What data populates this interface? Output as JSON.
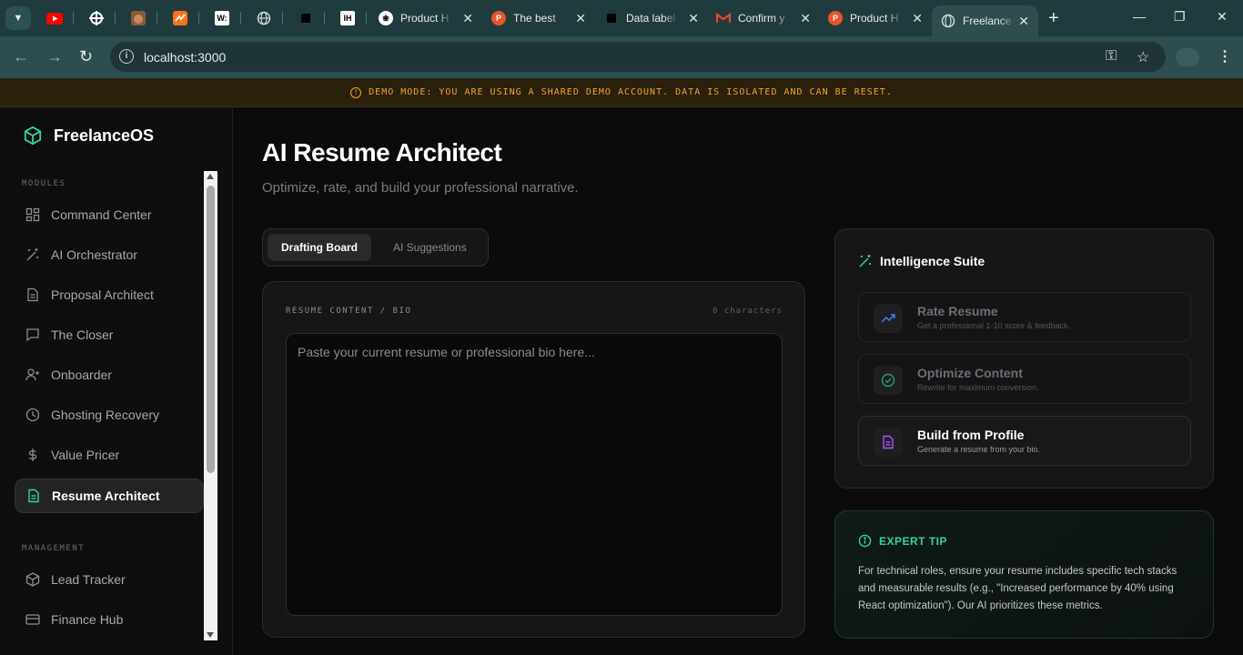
{
  "browser": {
    "tabs": [
      {
        "title": "Product H",
        "favicon": "openai-icon"
      },
      {
        "title": "The best",
        "favicon": "producthunt-icon"
      },
      {
        "title": "Data label",
        "favicon": "black-square-icon"
      },
      {
        "title": "Confirm y",
        "favicon": "gmail-icon"
      },
      {
        "title": "Product H",
        "favicon": "producthunt-icon"
      },
      {
        "title": "Freelance",
        "favicon": "globe-icon",
        "active": true
      }
    ],
    "pinned_labels": {
      "w": "W:",
      "ih": "IH"
    },
    "url": "localhost:3000"
  },
  "banner": {
    "text": "DEMO MODE: YOU ARE USING A SHARED DEMO ACCOUNT. DATA IS ISOLATED AND CAN BE RESET.",
    "color": "#f2a431"
  },
  "sidebar": {
    "brand": "FreelanceOS",
    "modules_label": "MODULES",
    "modules": [
      {
        "label": "Command Center",
        "icon": "grid-icon"
      },
      {
        "label": "AI Orchestrator",
        "icon": "magic-wand-icon"
      },
      {
        "label": "Proposal Architect",
        "icon": "document-icon"
      },
      {
        "label": "The Closer",
        "icon": "chat-icon"
      },
      {
        "label": "Onboarder",
        "icon": "user-plus-icon"
      },
      {
        "label": "Ghosting Recovery",
        "icon": "clock-icon"
      },
      {
        "label": "Value Pricer",
        "icon": "dollar-icon"
      },
      {
        "label": "Resume Architect",
        "icon": "document-icon",
        "active": true
      }
    ],
    "management_label": "MANAGEMENT",
    "management": [
      {
        "label": "Lead Tracker",
        "icon": "box-icon"
      },
      {
        "label": "Finance Hub",
        "icon": "card-icon"
      }
    ]
  },
  "main": {
    "title": "AI Resume Architect",
    "subtitle": "Optimize, rate, and build your professional narrative.",
    "tabs": [
      {
        "label": "Drafting Board",
        "active": true
      },
      {
        "label": "AI Suggestions"
      }
    ],
    "editor": {
      "label": "RESUME CONTENT / BIO",
      "count": "0 characters",
      "placeholder": "Paste your current resume or professional bio here..."
    },
    "suite": {
      "title": "Intelligence Suite",
      "actions": [
        {
          "name": "Rate Resume",
          "desc": "Get a professional 1-10 score & feedback.",
          "icon": "trending-up-icon",
          "enabled": false
        },
        {
          "name": "Optimize Content",
          "desc": "Rewrite for maximum conversion.",
          "icon": "check-circle-icon",
          "enabled": false
        },
        {
          "name": "Build from Profile",
          "desc": "Generate a resume from your bio.",
          "icon": "file-text-icon",
          "enabled": true
        }
      ]
    },
    "tip": {
      "title": "EXPERT TIP",
      "body": "For technical roles, ensure your resume includes specific tech stacks and measurable results (e.g., \"Increased performance by 40% using React optimization\"). Our AI prioritizes these metrics."
    }
  },
  "colors": {
    "accent": "#34d399",
    "purple": "#a855f7",
    "blue": "#3b82f6"
  }
}
